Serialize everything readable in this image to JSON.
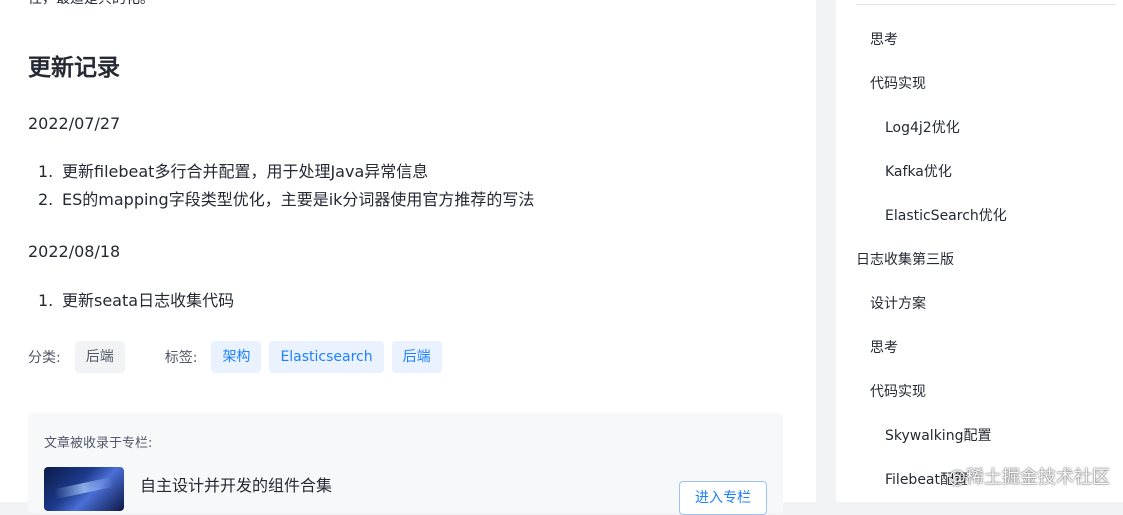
{
  "article": {
    "cut_text": "性，最适是共的化。",
    "update_heading": "更新记录",
    "updates": [
      {
        "date": "2022/07/27",
        "items": [
          {
            "num": "1.",
            "text": "更新filebeat多行合并配置，用于处理Java异常信息"
          },
          {
            "num": "2.",
            "text": "ES的mapping字段类型优化，主要是ik分词器使用官方推荐的写法"
          }
        ]
      },
      {
        "date": "2022/08/18",
        "items": [
          {
            "num": "1.",
            "text": "更新seata日志收集代码"
          }
        ]
      }
    ],
    "meta": {
      "category_label": "分类:",
      "category": "后端",
      "tags_label": "标签:",
      "tags": [
        "架构",
        "Elasticsearch",
        "后端"
      ]
    },
    "column": {
      "heading": "文章被收录于专栏:",
      "title": "自主设计并开发的组件合集",
      "enter_label": "进入专栏"
    }
  },
  "toc": {
    "items": [
      {
        "label": "思考",
        "level": 2
      },
      {
        "label": "代码实现",
        "level": 2
      },
      {
        "label": "Log4j2优化",
        "level": 3
      },
      {
        "label": "Kafka优化",
        "level": 3
      },
      {
        "label": "ElasticSearch优化",
        "level": 3
      },
      {
        "label": "日志收集第三版",
        "level": 1
      },
      {
        "label": "设计方案",
        "level": 2
      },
      {
        "label": "思考",
        "level": 2
      },
      {
        "label": "代码实现",
        "level": 2
      },
      {
        "label": "Skywalking配置",
        "level": 3
      },
      {
        "label": "Filebeat配置",
        "level": 3
      }
    ]
  },
  "watermark": "@稀土掘金技术社区",
  "colors": {
    "accent": "#1e80ff",
    "tag_bg": "#eaf2ff",
    "page_bg": "#f2f3f5"
  }
}
